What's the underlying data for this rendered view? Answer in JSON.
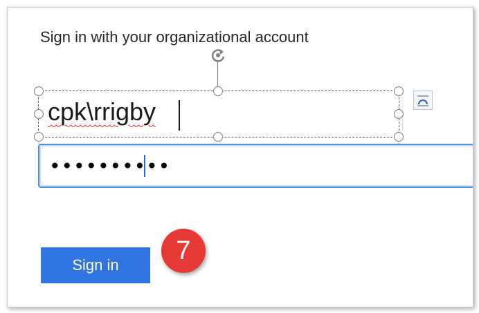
{
  "heading": "Sign in with your organizational account",
  "username": {
    "value": "cpk\\rrigby"
  },
  "password": {
    "value": "••••••••••"
  },
  "signin_button": {
    "label": "Sign in"
  },
  "step_badge": {
    "label": "7"
  },
  "colors": {
    "button": "#2f74e0",
    "badge": "#e53935",
    "field_focus_border": "#4a90e2"
  },
  "icons": {
    "rotate": "rotate-handle-icon",
    "layout": "layout-options-icon"
  }
}
